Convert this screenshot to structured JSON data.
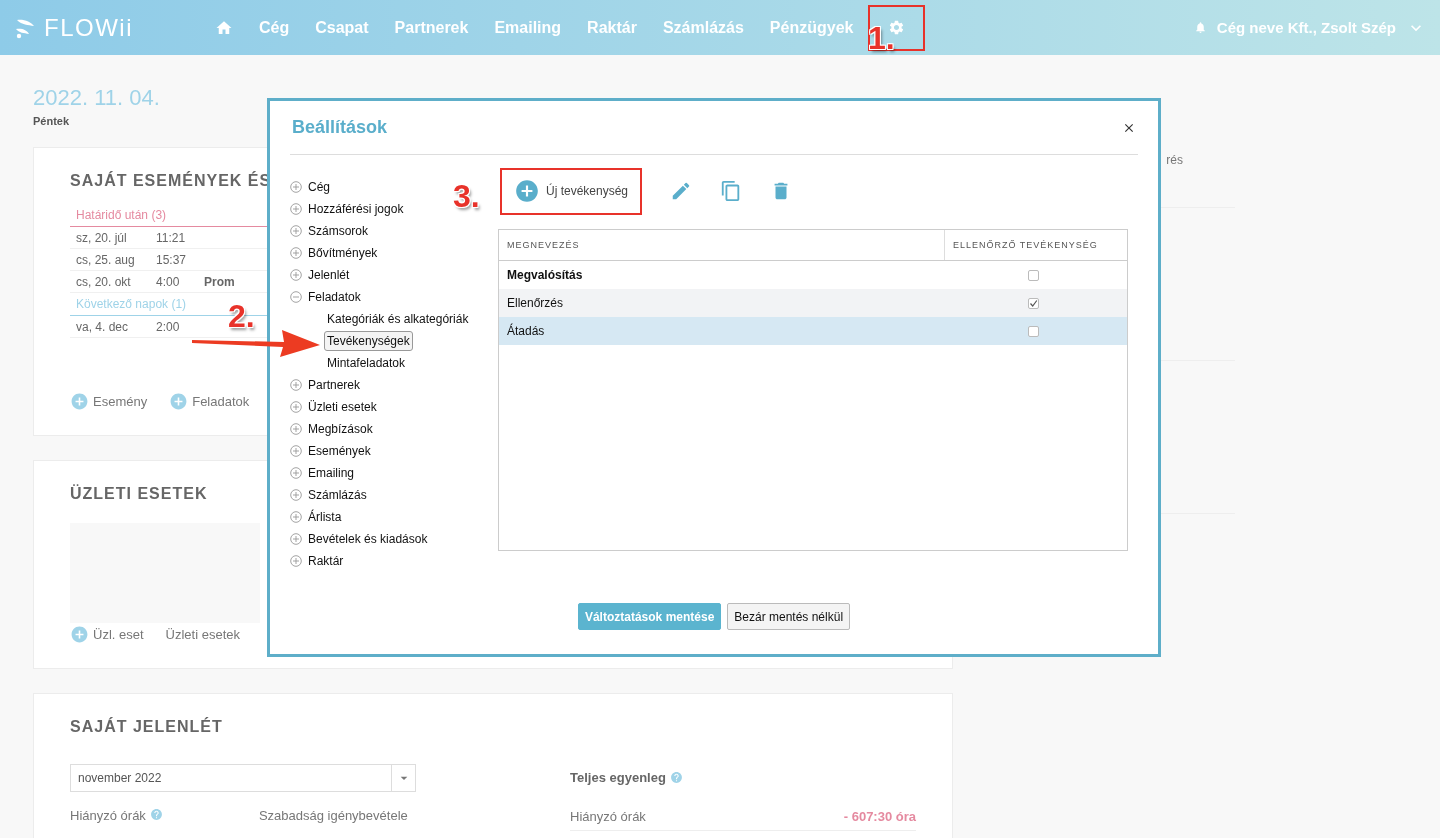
{
  "header": {
    "logo": "FLOWii",
    "nav": [
      {
        "kind": "home",
        "highlighted": false
      },
      {
        "kind": "link",
        "label": "Cég",
        "highlighted": false
      },
      {
        "kind": "link",
        "label": "Csapat",
        "highlighted": false
      },
      {
        "kind": "link",
        "label": "Partnerek",
        "highlighted": false
      },
      {
        "kind": "link",
        "label": "Emailing",
        "highlighted": false
      },
      {
        "kind": "link",
        "label": "Raktár",
        "highlighted": false
      },
      {
        "kind": "link",
        "label": "Számlázás",
        "highlighted": false
      },
      {
        "kind": "link",
        "label": "Pénzügyek",
        "highlighted": false
      },
      {
        "kind": "settings",
        "highlighted": true
      }
    ],
    "user": "Cég neve Kft., Zsolt Szép"
  },
  "page": {
    "date": "2022. 11. 04.",
    "weekday": "Péntek",
    "events_card": {
      "title": "SAJÁT ESEMÉNYEK ÉS",
      "groups": [
        {
          "kind": "overdue",
          "label": "Határidő után (3)",
          "rows": [
            {
              "day": "sz, 20. júl",
              "time": "11:21"
            },
            {
              "day": "cs, 25. aug",
              "time": "15:37"
            },
            {
              "day": "cs, 20. okt",
              "time": "4:00",
              "title": "Prom"
            }
          ]
        },
        {
          "kind": "upcoming",
          "label": "Következő napok (1)",
          "rows": [
            {
              "day": "va, 4. dec",
              "time": "2:00"
            }
          ]
        }
      ],
      "actions": [
        "Esemény",
        "Feladatok"
      ]
    },
    "deals_card": {
      "title": "ÜZLETI ESETEK",
      "add": "Üzl. eset",
      "link": "Üzleti esetek"
    },
    "attendance_card": {
      "title": "SAJÁT JELENLÉT",
      "month": "november 2022",
      "missing_label": "Hiányzó órák",
      "leave_label": "Szabadság igénybevétele",
      "balance_title": "Teljes egyenleg",
      "balance_rows": [
        {
          "label": "Hiányzó órák",
          "value": "- 607:30 óra"
        }
      ]
    },
    "side": {
      "line": "rés"
    }
  },
  "dialog": {
    "title": "Beállítások",
    "tree": [
      {
        "label": "Cég",
        "expanded": false
      },
      {
        "label": "Hozzáférési jogok",
        "expanded": false
      },
      {
        "label": "Számsorok",
        "expanded": false
      },
      {
        "label": "Bővítmények",
        "expanded": false
      },
      {
        "label": "Jelenlét",
        "expanded": false
      },
      {
        "label": "Feladatok",
        "expanded": true,
        "children": [
          {
            "label": "Kategóriák és alkategóriák",
            "selected": false
          },
          {
            "label": "Tevékenységek",
            "selected": true
          },
          {
            "label": "Mintafeladatok",
            "selected": false
          }
        ]
      },
      {
        "label": "Partnerek",
        "expanded": false
      },
      {
        "label": "Üzleti esetek",
        "expanded": false
      },
      {
        "label": "Megbízások",
        "expanded": false
      },
      {
        "label": "Események",
        "expanded": false
      },
      {
        "label": "Emailing",
        "expanded": false
      },
      {
        "label": "Számlázás",
        "expanded": false
      },
      {
        "label": "Árlista",
        "expanded": false
      },
      {
        "label": "Bevételek és kiadások",
        "expanded": false
      },
      {
        "label": "Raktár",
        "expanded": false
      }
    ],
    "new_button": {
      "label": "Új tevékenység",
      "highlighted": true
    },
    "table": {
      "columns": [
        "MEGNEVEZÉS",
        "ELLENŐRZŐ TEVÉKENYSÉG"
      ],
      "rows": [
        {
          "name": "Megvalósítás",
          "bold": true,
          "checked": false,
          "hovered": false,
          "selected": false
        },
        {
          "name": "Ellenőrzés",
          "bold": false,
          "checked": true,
          "hovered": true,
          "selected": false
        },
        {
          "name": "Átadás",
          "bold": false,
          "checked": false,
          "hovered": false,
          "selected": true
        }
      ]
    },
    "buttons": [
      {
        "kind": "primary",
        "label": "Változtatások mentése"
      },
      {
        "kind": "secondary",
        "label": "Bezár mentés nélkül"
      }
    ]
  },
  "annotations": [
    {
      "label": "1."
    },
    {
      "label": "2."
    },
    {
      "label": "3."
    }
  ]
}
